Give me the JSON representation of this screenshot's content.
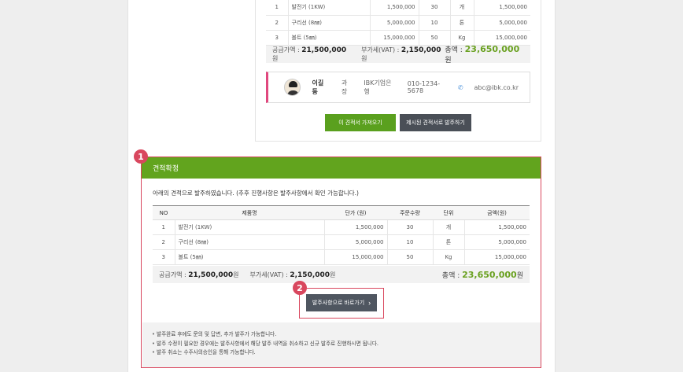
{
  "top_table": {
    "rows": [
      {
        "no": "1",
        "name": "발전기 (1KW)",
        "price": "1,500,000",
        "qty": "30",
        "unit": "개",
        "amount": "1,500,000"
      },
      {
        "no": "2",
        "name": "구리선 (8㎜)",
        "price": "5,000,000",
        "qty": "10",
        "unit": "톤",
        "amount": "5,000,000"
      },
      {
        "no": "3",
        "name": "볼트 (5㎜)",
        "price": "15,000,000",
        "qty": "50",
        "unit": "Kg",
        "amount": "15,000,000"
      }
    ]
  },
  "top_summary": {
    "supply_label": "공급가액 : ",
    "supply_value": "21,500,000",
    "won1": "원",
    "vat_label": "부가세(VAT) : ",
    "vat_value": "2,150,000",
    "won2": "원",
    "total_label": "총액 : ",
    "total_value": "23,650,000",
    "won3": "원"
  },
  "contact": {
    "name": "이길동",
    "title": "과장",
    "company": "IBK기업은행",
    "phone": "010-1234-5678",
    "email": "abc@ibk.co.kr",
    "phone_icon": "phone-icon"
  },
  "buttons": {
    "import_quote": "이 견적서 가져오기",
    "order_suggested": "제시된 견적서로 발주하기",
    "goto_order": "발주사항으로 바로가기"
  },
  "confirm": {
    "badge": "1",
    "title": "견적확정",
    "message": "아래의 견적으로 발주하였습니다. (추후 진행사항은 발주사항에서 확인 가능합니다.)",
    "headers": {
      "no": "NO",
      "name": "제품명",
      "price": "단가 (원)",
      "qty": "주문수량",
      "unit": "단위",
      "amount": "금액(원)"
    },
    "rows": [
      {
        "no": "1",
        "name": "발전기 (1KW)",
        "price": "1,500,000",
        "qty": "30",
        "unit": "개",
        "amount": "1,500,000"
      },
      {
        "no": "2",
        "name": "구리선 (8㎜)",
        "price": "5,000,000",
        "qty": "10",
        "unit": "톤",
        "amount": "5,000,000"
      },
      {
        "no": "3",
        "name": "볼트 (5㎜)",
        "price": "15,000,000",
        "qty": "50",
        "unit": "Kg",
        "amount": "15,000,000"
      }
    ]
  },
  "badge2": "2",
  "notes": [
    "발주완료 후에도 문의 및 답변, 추가 발주가 가능합니다.",
    "발주 수정이 필요한 경우에는 발주사항에서 해당 발주 내역을 취소하고 신규 발주로 진행하시면 됩니다.",
    "발주 취소는 수주사의승인을 통해 가능합니다."
  ],
  "colors": {
    "accent_green": "#62a41e",
    "highlight_red": "#d9475e",
    "dark_button": "#4a4f57"
  }
}
